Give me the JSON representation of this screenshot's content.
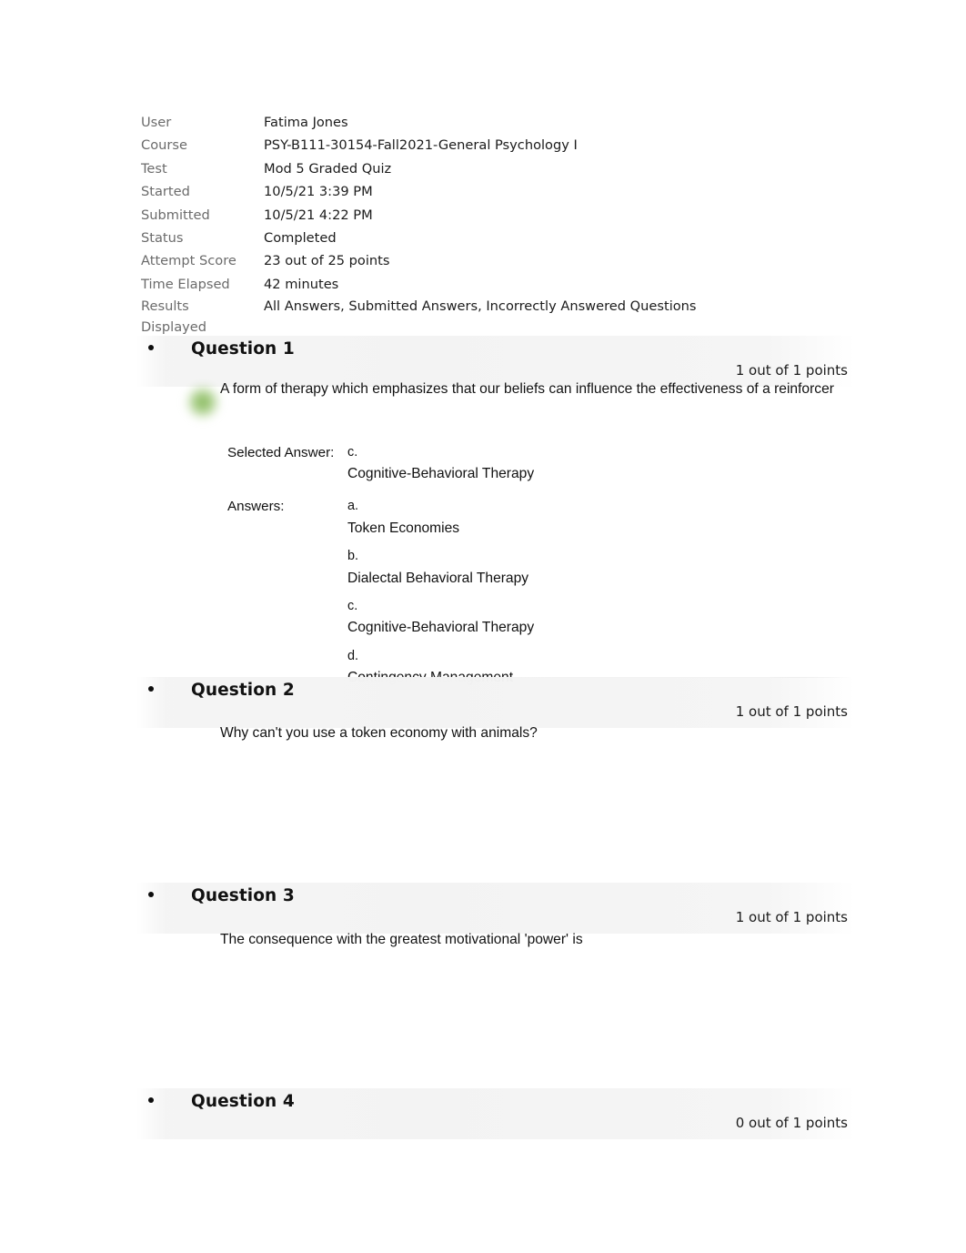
{
  "summary": {
    "rows": [
      {
        "label": "User",
        "value": "Fatima Jones"
      },
      {
        "label": "Course",
        "value": "PSY-B111-30154-Fall2021-General Psychology I"
      },
      {
        "label": "Test",
        "value": "Mod 5 Graded Quiz"
      },
      {
        "label": "Started",
        "value": "10/5/21 3:39 PM"
      },
      {
        "label": "Submitted",
        "value": "10/5/21 4:22 PM"
      },
      {
        "label": "Status",
        "value": "Completed"
      },
      {
        "label": "Attempt Score",
        "value": "23 out of 25 points"
      },
      {
        "label": "Time Elapsed",
        "value": "42 minutes"
      },
      {
        "label": "Results\nDisplayed",
        "value": "All Answers, Submitted Answers, Incorrectly Answered Questions"
      }
    ]
  },
  "questions": [
    {
      "title": "Question 1",
      "points": "1 out of 1 points",
      "text": "A form of therapy which emphasizes that our beliefs can influence the effectiveness of a reinforcer",
      "selected_answer_label": "Selected Answer:",
      "selected_answer_letter": "c.",
      "selected_answer_text": "Cognitive-Behavioral Therapy",
      "answers_label": "Answers:",
      "options": [
        {
          "letter": "a.",
          "text": "Token Economies"
        },
        {
          "letter": "b.",
          "text": "Dialectal Behavioral Therapy"
        },
        {
          "letter": "c.",
          "text": "Cognitive-Behavioral Therapy"
        },
        {
          "letter": "d.",
          "text": "Contingency Management"
        }
      ]
    },
    {
      "title": "Question 2",
      "points": "1 out of 1 points",
      "text": "Why can't you use a token economy with animals?"
    },
    {
      "title": "Question 3",
      "points": "1 out of 1 points",
      "text": "The consequence with the greatest motivational 'power' is"
    },
    {
      "title": "Question 4",
      "points": "0 out of 1 points",
      "text": ""
    }
  ],
  "indicators": {
    "correct_answer_marker_color": "#76b046"
  }
}
